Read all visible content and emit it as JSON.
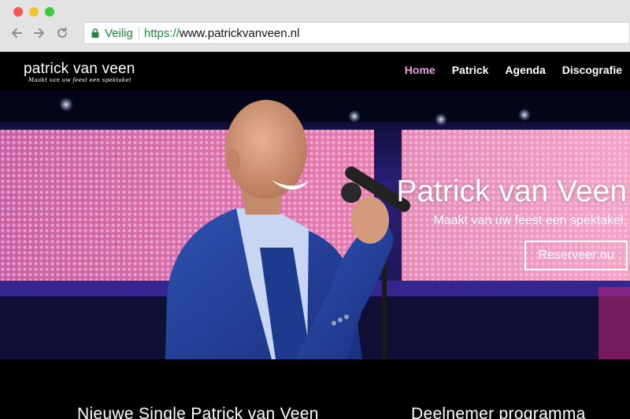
{
  "browser": {
    "secure_label": "Veilig",
    "url_scheme": "https://",
    "url_host": "www.patrickvanveen.nl",
    "icons": [
      "back-arrow-icon",
      "forward-arrow-icon",
      "reload-icon",
      "lock-icon"
    ]
  },
  "site": {
    "logo_name": "patrick van veen",
    "logo_tagline": "Maakt van uw feest een spektakel",
    "nav": [
      {
        "label": "Home",
        "active": true
      },
      {
        "label": "Patrick",
        "active": false
      },
      {
        "label": "Agenda",
        "active": false
      },
      {
        "label": "Discografie",
        "active": false
      }
    ],
    "accent_color": "#ec9fe3"
  },
  "hero": {
    "title": "Patrick van Veen",
    "subtitle": "Maakt van uw feest een spektakel.",
    "cta_label": "Reserveer nu"
  },
  "sections": {
    "left_title": "Nieuwe Single Patrick van Veen",
    "right_title": "Deelnemer programma"
  }
}
